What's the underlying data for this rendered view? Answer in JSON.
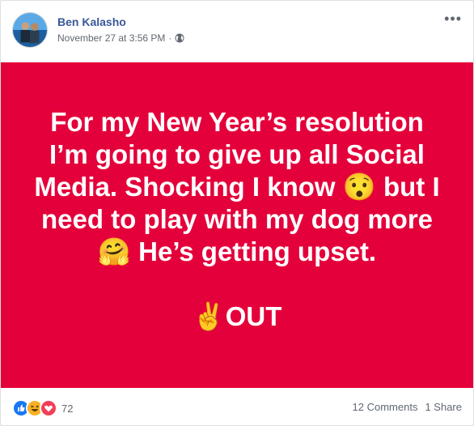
{
  "post": {
    "author": "Ben Kalasho",
    "timestamp": "November 27 at 3:56 PM",
    "separator": "·",
    "privacy_icon": "globe-icon",
    "more_icon": "more-options-icon",
    "more_label": "•••",
    "background_color": "#e4003a",
    "text": "For my New Year’s resolution I’m going to give up all Social Media. Shocking I know 😯 but I need to play with my dog more 🤗 He’s getting upset.\n\n✌️OUT"
  },
  "footer": {
    "reaction_icons": [
      "like-reaction-icon",
      "haha-reaction-icon",
      "love-reaction-icon"
    ],
    "reaction_count": "72",
    "comments": "12 Comments",
    "shares": "1 Share"
  },
  "colors": {
    "author_link": "#385898",
    "meta_text": "#616770",
    "like_blue": "#1877f2",
    "haha_yellow": "#f7b125",
    "love_red": "#f33e58"
  }
}
